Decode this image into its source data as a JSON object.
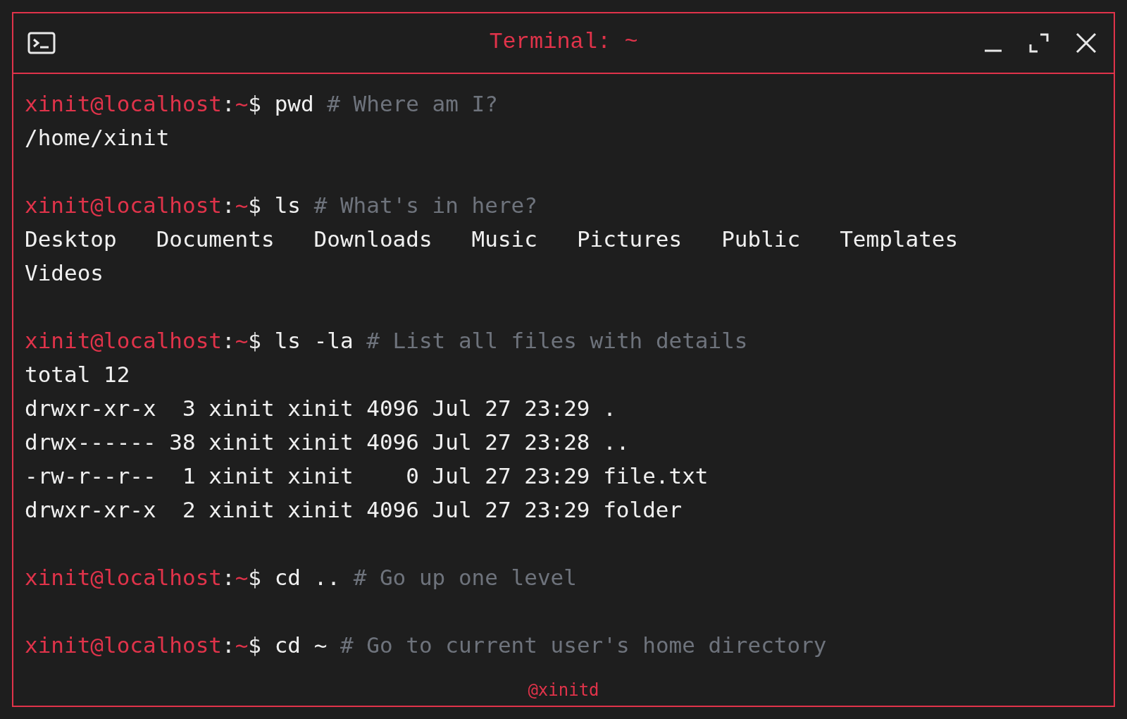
{
  "window": {
    "title": "Terminal: ~"
  },
  "lines": [
    {
      "kind": "command",
      "user": "xinit@localhost",
      "sep": ":",
      "path": "~",
      "symbol": "$",
      "command": "pwd",
      "comment": "# Where am I?"
    },
    {
      "kind": "output",
      "text": "/home/xinit"
    },
    {
      "kind": "blank"
    },
    {
      "kind": "command",
      "user": "xinit@localhost",
      "sep": ":",
      "path": "~",
      "symbol": "$",
      "command": "ls",
      "comment": "# What's in here?"
    },
    {
      "kind": "listing",
      "rows": [
        [
          "Desktop",
          "Documents",
          "Downloads",
          "Music",
          "Pictures",
          "Public",
          "Templates"
        ],
        [
          "Videos"
        ]
      ]
    },
    {
      "kind": "blank"
    },
    {
      "kind": "command",
      "user": "xinit@localhost",
      "sep": ":",
      "path": "~",
      "symbol": "$",
      "command": "ls -la",
      "comment": "# List all files with details"
    },
    {
      "kind": "output",
      "text": "total 12"
    },
    {
      "kind": "output",
      "text": "drwxr-xr-x  3 xinit xinit 4096 Jul 27 23:29 ."
    },
    {
      "kind": "output",
      "text": "drwx------ 38 xinit xinit 4096 Jul 27 23:28 .."
    },
    {
      "kind": "output",
      "text": "-rw-r--r--  1 xinit xinit    0 Jul 27 23:29 file.txt"
    },
    {
      "kind": "output",
      "text": "drwxr-xr-x  2 xinit xinit 4096 Jul 27 23:29 folder"
    },
    {
      "kind": "blank"
    },
    {
      "kind": "command",
      "user": "xinit@localhost",
      "sep": ":",
      "path": "~",
      "symbol": "$",
      "command": "cd ..",
      "comment": "# Go up one level"
    },
    {
      "kind": "blank"
    },
    {
      "kind": "command",
      "user": "xinit@localhost",
      "sep": ":",
      "path": "~",
      "symbol": "$",
      "command": "cd ~",
      "comment": "# Go to current user's home directory"
    }
  ],
  "footer": "@xinitd"
}
